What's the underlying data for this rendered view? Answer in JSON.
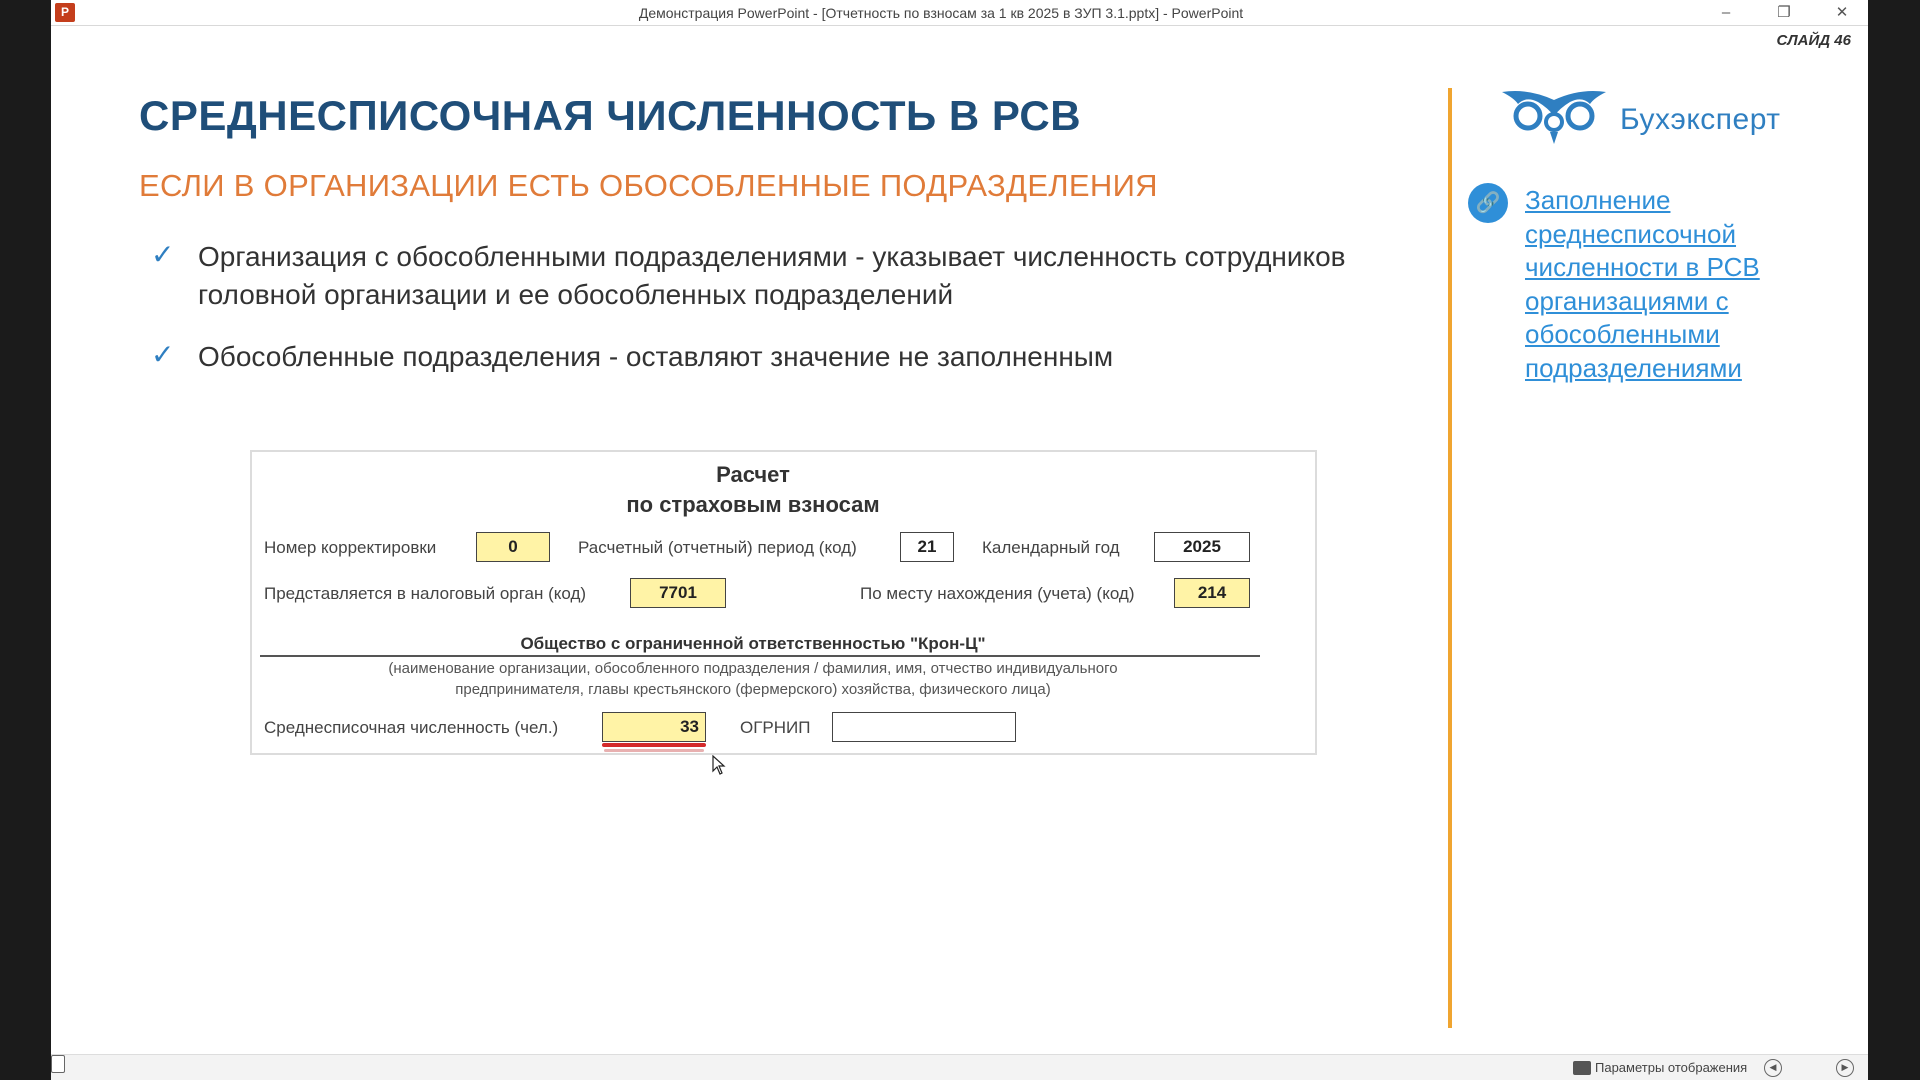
{
  "window": {
    "title": "Демонстрация PowerPoint - [Отчетность по взносам за 1 кв 2025 в ЗУП 3.1.pptx] - PowerPoint",
    "app_icon_letter": "P",
    "controls": {
      "minimize": "–",
      "restore": "❐",
      "close": "✕"
    }
  },
  "slide": {
    "number_label": "СЛАЙД 46",
    "title": "СРЕДНЕСПИСОЧНАЯ ЧИСЛЕННОСТЬ В РСВ",
    "subtitle": "ЕСЛИ В ОРГАНИЗАЦИИ ЕСТЬ ОБОСОБЛЕННЫЕ ПОДРАЗДЕЛЕНИЯ",
    "bullets": [
      {
        "icon": "check-icon",
        "text": "Организация с обособленными подразделениями - указывает численность сотрудников головной организации и ее обособленных подразделений"
      },
      {
        "icon": "check-icon",
        "text": "Обособленные подразделения - оставляют значение не заполненным"
      }
    ],
    "check_glyph": "✓"
  },
  "form": {
    "title_line1": "Расчет",
    "title_line2": "по страховым взносам",
    "correction_label": "Номер корректировки",
    "correction_value": "0",
    "period_label": "Расчетный (отчетный) период (код)",
    "period_value": "21",
    "year_label": "Календарный год",
    "year_value": "2025",
    "tax_organ_label": "Представляется в налоговый орган (код)",
    "tax_organ_value": "7701",
    "location_label": "По месту нахождения (учета) (код)",
    "location_value": "214",
    "org_name": "Общество с ограниченной ответственностью \"Крон-Ц\"",
    "org_hint_line1": "(наименование организации, обособленного подразделения / фамилия, имя, отчество индивидуального",
    "org_hint_line2": "предпринимателя, главы крестьянского (фермерского) хозяйства, физического лица)",
    "headcount_label": "Среднесписочная численность (чел.)",
    "headcount_value": "33",
    "ogrnip_label": "ОГРНИП",
    "ogrnip_value": "",
    "highlight_color": "#fff3a6",
    "underline_color": "#d42a2a"
  },
  "sidebar": {
    "brand_name": "Бухэксперт",
    "brand_icon": "owl-logo-icon",
    "link_icon": "link-icon",
    "link_lines": [
      "Заполнение",
      "среднесписочной",
      "численности в РСВ",
      "организациями с",
      "обособленными",
      "подразделениями"
    ],
    "accent_color": "#f0a530",
    "link_color": "#2f8fd8"
  },
  "statusbar": {
    "display_settings": "Параметры отображения"
  },
  "colors": {
    "title": "#1f4e79",
    "subtitle": "#e07b39",
    "check": "#2f7fc1"
  }
}
